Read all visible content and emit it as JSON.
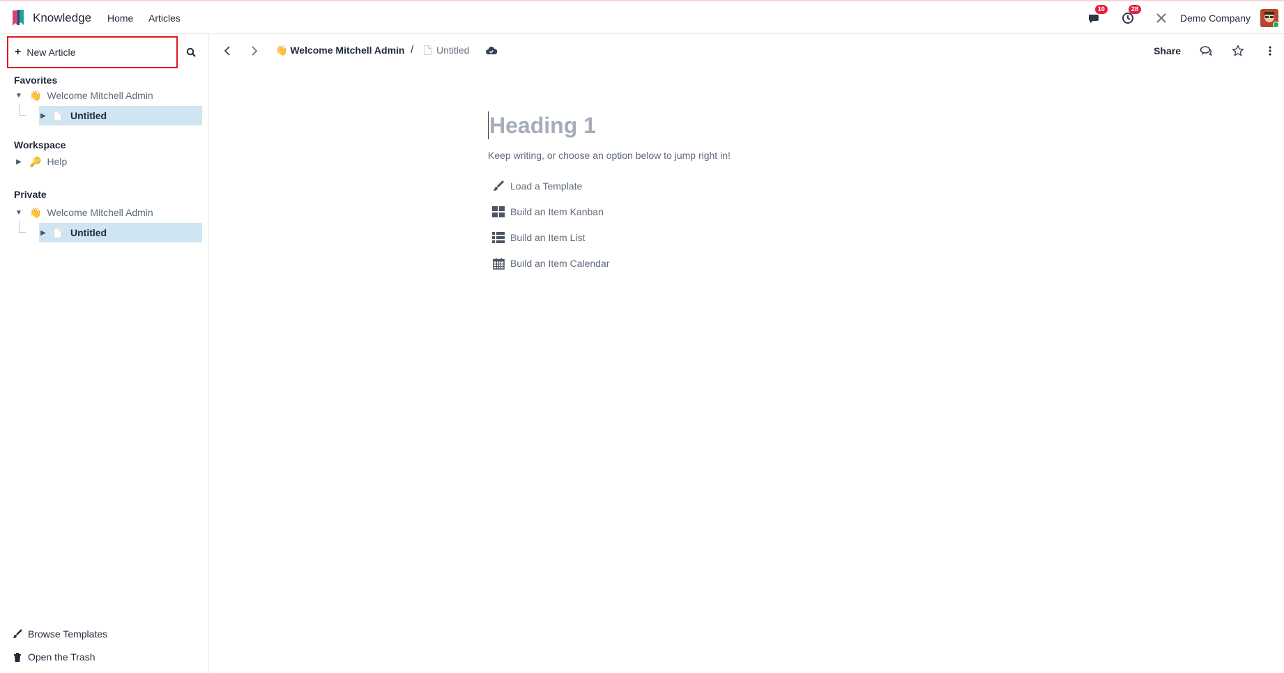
{
  "navbar": {
    "app_name": "Knowledge",
    "links": [
      "Home",
      "Articles"
    ],
    "messages_count": "10",
    "activities_count": "28",
    "company": "Demo Company"
  },
  "sidebar": {
    "new_article_label": "New Article",
    "sections": {
      "favorites": {
        "title": "Favorites",
        "parent": {
          "emoji": "👋",
          "label": "Welcome Mitchell Admin"
        },
        "child": {
          "label": "Untitled"
        }
      },
      "workspace": {
        "title": "Workspace",
        "item": {
          "emoji": "🔑",
          "label": "Help"
        }
      },
      "private": {
        "title": "Private",
        "parent": {
          "emoji": "👋",
          "label": "Welcome Mitchell Admin"
        },
        "child": {
          "label": "Untitled"
        }
      }
    },
    "footer": {
      "browse_templates": "Browse Templates",
      "open_trash": "Open the Trash"
    }
  },
  "header": {
    "breadcrumb_emoji": "👋",
    "breadcrumb_root": "Welcome Mitchell Admin",
    "breadcrumb_separator": "/",
    "breadcrumb_current": "Untitled",
    "share_label": "Share"
  },
  "editor": {
    "heading_placeholder": "Heading 1",
    "hint": "Keep writing, or choose an option below to jump right in!",
    "options": [
      "Load a Template",
      "Build an Item Kanban",
      "Build an Item List",
      "Build an Item Calendar"
    ]
  },
  "colors": {
    "selected_bg": "#cfe6f2",
    "badge": "#e0203e",
    "highlight_border": "#e0191e"
  }
}
